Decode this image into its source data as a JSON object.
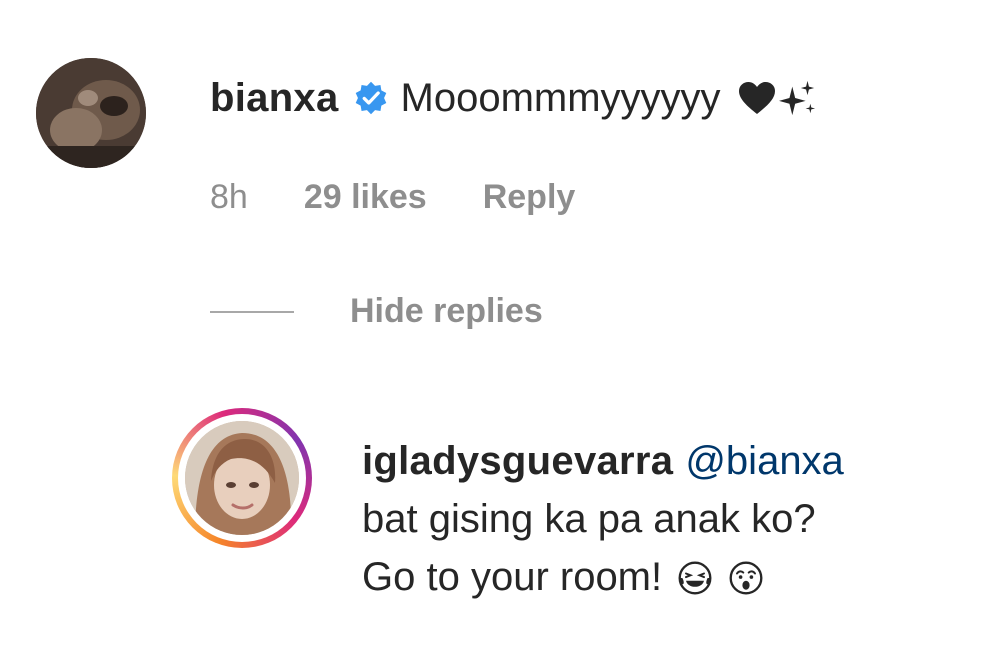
{
  "comment": {
    "username": "bianxa",
    "verified_icon": "verified-badge-icon",
    "text": "Mooommmyyyyyy",
    "emojis": [
      "black-heart-icon",
      "sparkles-icon"
    ],
    "time": "8h",
    "likes": "29 likes",
    "reply_label": "Reply",
    "avatar_icon": "user-avatar"
  },
  "replies_toggle": {
    "label": "Hide replies"
  },
  "reply": {
    "username": "igladysguevarra",
    "mention": "@bianxa",
    "line1": "bat gising ka pa anak ko?",
    "line2": "Go to your room!",
    "emojis": [
      "laughing-tears-icon",
      "surprised-face-icon"
    ],
    "avatar_icon": "user-avatar-story-ring"
  },
  "colors": {
    "text": "#262626",
    "secondary": "#8e8e8e",
    "mention": "#00376b",
    "verified": "#3897f0",
    "story_ring": [
      "#f58529",
      "#dd2a7b",
      "#8134af"
    ]
  }
}
